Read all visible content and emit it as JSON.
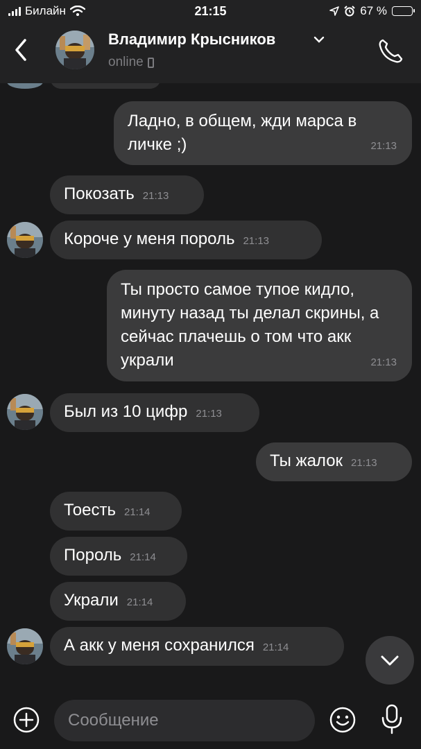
{
  "status_bar": {
    "carrier": "Билайн",
    "time": "21:15",
    "battery": "67 %",
    "battery_level": 0.67,
    "colors": {
      "battery": "#f5c400"
    }
  },
  "header": {
    "name": "Владимир Крысников",
    "status": "online"
  },
  "messages": [
    {
      "dir": "out",
      "text": "Ладно, в общем, жди марса в личке ;)",
      "time": "21:13"
    },
    {
      "dir": "in",
      "text": "Покозать",
      "time": "21:13"
    },
    {
      "dir": "in",
      "text": "Короче у меня пороль",
      "time": "21:13"
    },
    {
      "dir": "out",
      "text": "Ты просто самое тупое кидло, минуту назад ты делал скрины, а сейчас плачешь о том что акк украли",
      "time": "21:13"
    },
    {
      "dir": "in",
      "text": "Был из 10 цифр",
      "time": "21:13"
    },
    {
      "dir": "out",
      "text": "Ты жалок",
      "time": "21:13"
    },
    {
      "dir": "in",
      "text": "Тоесть",
      "time": "21:14"
    },
    {
      "dir": "in",
      "text": "Пороль",
      "time": "21:14"
    },
    {
      "dir": "in",
      "text": "Украли",
      "time": "21:14"
    },
    {
      "dir": "in",
      "text": "А акк у меня сохранился",
      "time": "21:14"
    }
  ],
  "composer": {
    "placeholder": "Сообщение"
  },
  "icons": [
    "back-icon",
    "chevron-down-icon",
    "phone-icon",
    "call-icon",
    "plus-icon",
    "smile-icon",
    "mic-icon",
    "scroll-down-icon"
  ]
}
